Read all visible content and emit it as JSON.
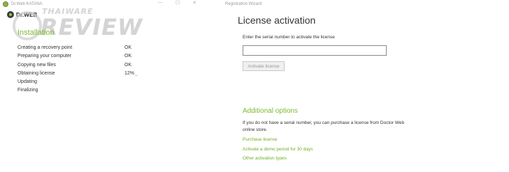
{
  "installer": {
    "window_title": "Dr.Web KATANA",
    "logo_text": "Dr.WEB",
    "section_title": "Installation",
    "steps": [
      {
        "label": "Creating a recovery point",
        "status": "OK"
      },
      {
        "label": "Preparing your computer",
        "status": "OK"
      },
      {
        "label": "Copying new files",
        "status": "OK"
      },
      {
        "label": "Obtaining license",
        "status": "12%"
      },
      {
        "label": "Updating",
        "status": ""
      },
      {
        "label": "Finalizing",
        "status": ""
      }
    ],
    "progress_indicator": "..",
    "window_controls": [
      "—",
      "☐",
      "✕"
    ]
  },
  "wizard": {
    "window_title": "Registration Wizard",
    "title": "License activation",
    "serial_prompt": "Enter the serial number to activate the license",
    "serial_value": "",
    "activate_button": "Activate license",
    "additional_title": "Additional options",
    "additional_description": "If you do not have a serial number, you can purchase a license from Doctor Web online store.",
    "links": {
      "purchase": "Purchase license",
      "demo": "Activate a demo period for 30 days",
      "other": "Other activation types"
    }
  },
  "watermark": {
    "top_text": "THAIWARE",
    "big_text": "REVIEW"
  },
  "colors": {
    "accent_green": "#7cba2d",
    "link_green": "#6fae23",
    "text": "#333333",
    "muted": "#9a9a9a"
  }
}
